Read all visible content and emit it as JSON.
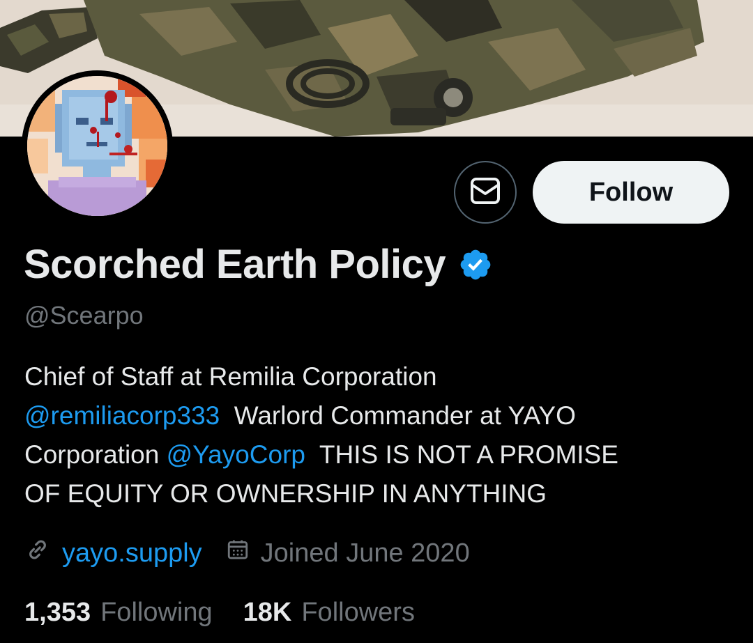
{
  "profile": {
    "display_name": "Scorched Earth Policy",
    "handle": "@Scearpo",
    "verified": true,
    "bio": {
      "line1": "Chief of Staff at Remilia Corporation",
      "mention1": "@remiliacorp333",
      "text2": "Warlord Commander at YAYO",
      "text3": "Corporation",
      "mention2": "@YayoCorp",
      "text4": "THIS IS NOT A PROMISE",
      "text5": "OF EQUITY OR OWNERSHIP IN ANYTHING"
    },
    "website": "yayo.supply",
    "joined": "Joined June 2020",
    "following_count": "1,353",
    "following_label": "Following",
    "followers_count": "18K",
    "followers_label": "Followers"
  },
  "actions": {
    "follow_label": "Follow"
  },
  "icons": {
    "message": "envelope-icon",
    "verified": "verified-badge-icon",
    "link": "link-icon",
    "calendar": "calendar-icon"
  },
  "colors": {
    "background": "#000000",
    "accent": "#1d9bf0",
    "primary_text": "#e7e9ea",
    "secondary_text": "#71767b",
    "follow_button_bg": "#eff3f4"
  }
}
